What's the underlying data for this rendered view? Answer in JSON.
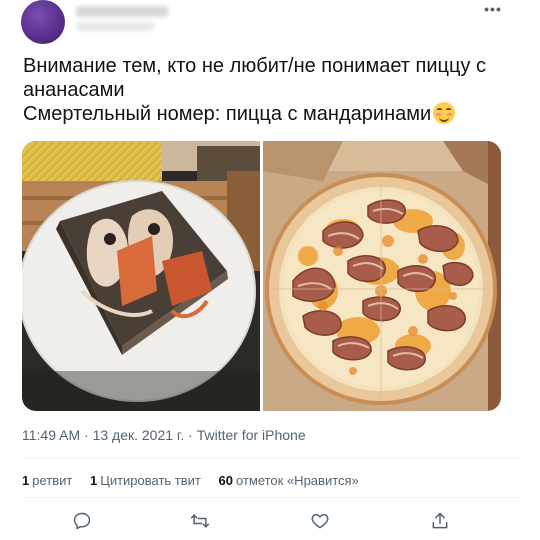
{
  "author": {
    "name": "",
    "handle": ""
  },
  "menu": {
    "more_label": "•••"
  },
  "tweet": {
    "lines": [
      "Внимание тем, кто не любит/не понимает пиццу с",
      "ананасами",
      "Смертельный номер: пицца с мандаринами"
    ],
    "emoji": "smiling-face-with-smiling-eyes"
  },
  "media": {
    "images": [
      {
        "icon": "pizza-box-photo"
      },
      {
        "icon": "pizza-with-mandarins-photo"
      }
    ]
  },
  "meta": {
    "time": "11:49 AM",
    "separator1": " · ",
    "date": "13 дек. 2021 г.",
    "separator2": " · ",
    "source": "Twitter for iPhone"
  },
  "stats": {
    "retweets_count": "1",
    "retweets_label": "ретвит",
    "quotes_count": "1",
    "quotes_label": "Цитировать твит",
    "likes_count": "60",
    "likes_label": "отметок «Нравится»"
  },
  "actions": [
    "reply-icon",
    "retweet-icon",
    "like-icon",
    "share-icon"
  ],
  "colors": {
    "text": "#0f1419",
    "secondary": "#536471",
    "divider": "#eff3f4"
  }
}
